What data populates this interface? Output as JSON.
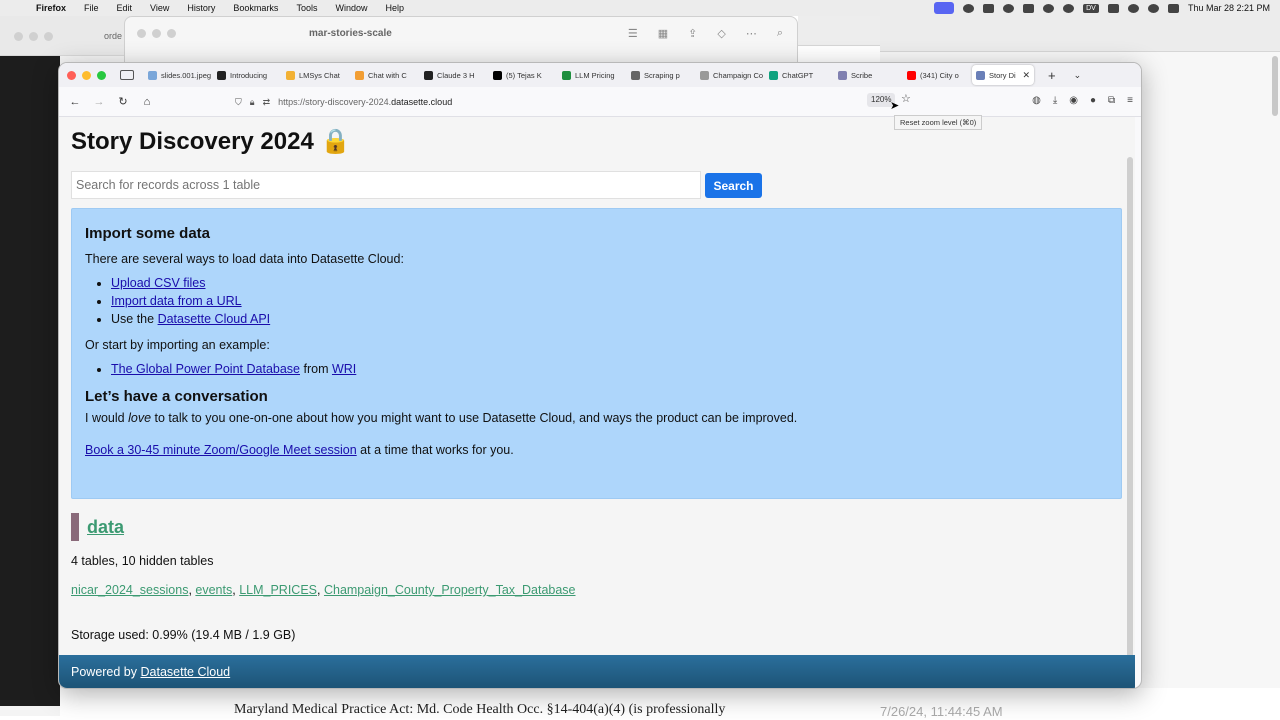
{
  "menubar": {
    "app": "Firefox",
    "items": [
      "File",
      "Edit",
      "View",
      "History",
      "Bookmarks",
      "Tools",
      "Window",
      "Help"
    ],
    "clock": "Thu Mar 28  2:21 PM",
    "dv_label": "DV"
  },
  "background": {
    "left_window_partial": "orde",
    "finder_title": "mar-stories-scale",
    "doc_text": "Maryland Medical Practice Act: Md. Code Health Occ. §14-404(a)(4) (is professionally",
    "doc_text_right": "7/26/24, 11:44:45 AM"
  },
  "tabs": [
    {
      "label": "slides.001.jpeg",
      "color": "#7aa6d9"
    },
    {
      "label": "Introducing",
      "color": "#222222"
    },
    {
      "label": "LMSys Chat",
      "color": "#f2b134"
    },
    {
      "label": "Chat with C",
      "color": "#f29e34"
    },
    {
      "label": "Claude 3 H",
      "color": "#222222"
    },
    {
      "label": "(5) Tejas K",
      "color": "#000000"
    },
    {
      "label": "LLM Pricing",
      "color": "#1e8e3e"
    },
    {
      "label": "Scraping p",
      "color": "#666666"
    },
    {
      "label": "Champaign Co",
      "color": "#999999"
    },
    {
      "label": "ChatGPT",
      "color": "#10a37f"
    },
    {
      "label": "Scribe",
      "color": "#8080b0"
    },
    {
      "label": "(341) City o",
      "color": "#ff0000"
    },
    {
      "label": "Story Di",
      "color": "#6a7fb8",
      "active": true
    }
  ],
  "navbar": {
    "url_prefix": "https://story-discovery-2024.",
    "url_host": "datasette.cloud",
    "zoom": "120%",
    "tooltip": "Reset zoom level (⌘0)"
  },
  "page": {
    "title": "Story Discovery 2024 🔒",
    "search_placeholder": "Search for records across 1 table",
    "search_button": "Search",
    "import": {
      "heading": "Import some data",
      "intro": "There are several ways to load data into Datasette Cloud:",
      "upload_csv": "Upload CSV files",
      "import_url": "Import data from a URL",
      "use_the": "Use the",
      "api_link": "Datasette Cloud API",
      "example_intro": "Or start by importing an example:",
      "example_link": "The Global Power Point Database",
      "from": "from",
      "wri": "WRI",
      "conv_heading": "Let’s have a conversation",
      "conv_pre": "I would",
      "conv_em": "love",
      "conv_post": "to talk to you one-on-one about how you might want to use Datasette Cloud, and ways the product can be improved.",
      "book_link": "Book a 30-45 minute Zoom/Google Meet session",
      "book_post": "at a time that works for you."
    },
    "database": {
      "name": "data",
      "tables_count": "4 tables, 10 hidden tables",
      "tables": [
        "nicar_2024_sessions",
        "events",
        "LLM_PRICES",
        "Champaign_County_Property_Tax_Database"
      ],
      "storage": "Storage used: 0.99% (19.4 MB / 1.9 GB)"
    },
    "footer": {
      "powered_by": "Powered by",
      "link": "Datasette Cloud"
    }
  }
}
